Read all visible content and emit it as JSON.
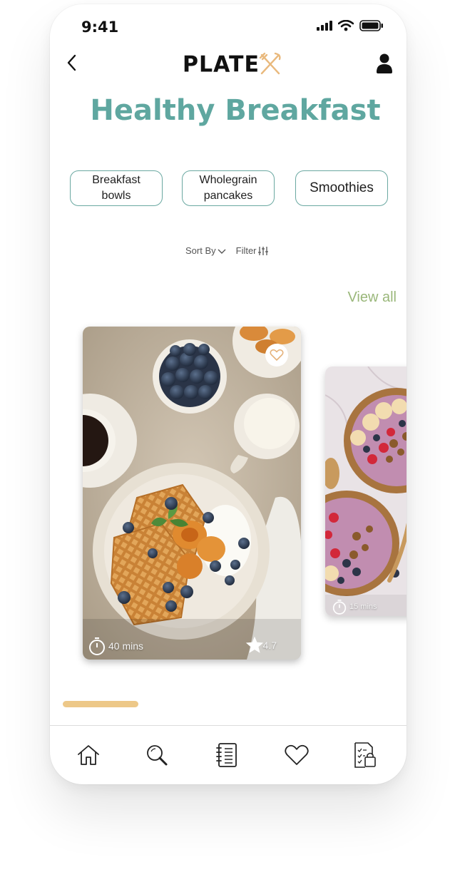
{
  "status_bar": {
    "time": "9:41"
  },
  "header": {
    "logo_text": "PLATE",
    "back_label": "back",
    "profile_label": "profile"
  },
  "page": {
    "title": "Healthy Breakfast"
  },
  "chips": [
    {
      "line1": "Breakfast",
      "line2": "bowls"
    },
    {
      "line1": "Wholegrain",
      "line2": "pancakes"
    },
    {
      "line1": "Smoothies",
      "line2": ""
    }
  ],
  "toolbar": {
    "sort_label": "Sort By",
    "filter_label": "Filter"
  },
  "section": {
    "view_all_label": "View all"
  },
  "cards": [
    {
      "time": "40 mins",
      "rating": "4.7",
      "favorite": false
    },
    {
      "time": "15 mins"
    }
  ],
  "colors": {
    "accent_teal": "#5fa7a0",
    "view_all_green": "#9ab77a",
    "indicator_gold": "#edc888"
  },
  "nav": [
    {
      "icon": "home-icon"
    },
    {
      "icon": "search-icon"
    },
    {
      "icon": "recipe-book-icon"
    },
    {
      "icon": "heart-icon"
    },
    {
      "icon": "shopping-list-icon"
    }
  ]
}
